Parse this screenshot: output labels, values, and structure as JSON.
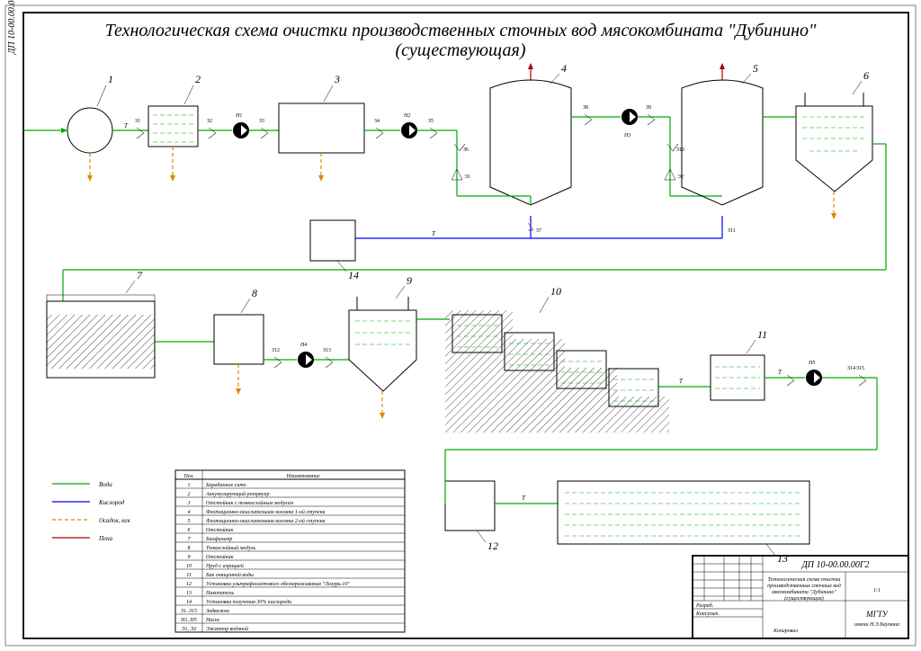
{
  "title_l1": "Технологическая схема очистки производственных сточных вод мясокомбината \"Дубинино\"",
  "title_l2": "(существующая)",
  "frame_code": "ДП 10-00.00.00Г2",
  "legend": {
    "water": "Вода",
    "oxygen": "Кислород",
    "sludge": "Осадок, кек",
    "foam": "Пена"
  },
  "header": {
    "pos": "Поз.",
    "name": "Наименование"
  },
  "equip": [
    {
      "p": "1",
      "n": "Барабанное сито"
    },
    {
      "p": "2",
      "n": "Аккумулирующий резервуар"
    },
    {
      "p": "3",
      "n": "Отстойник с тонкослойным модулем"
    },
    {
      "p": "4",
      "n": "Флотационно-окислительная колонна 1-ой ступени"
    },
    {
      "p": "5",
      "n": "Флотационно-окислительная колонна 2-ой ступени"
    },
    {
      "p": "6",
      "n": "Отстойник"
    },
    {
      "p": "7",
      "n": "Биофильтр"
    },
    {
      "p": "8",
      "n": "Тонкослойный модуль"
    },
    {
      "p": "9",
      "n": "Отстойник"
    },
    {
      "p": "10",
      "n": "Пруд с аэрацией"
    },
    {
      "p": "11",
      "n": "Бак очищенной воды"
    },
    {
      "p": "12",
      "n": "Установка ультрафиолетового обеззараживания \"Лазурь-10\""
    },
    {
      "p": "13",
      "n": "Накопитель"
    },
    {
      "p": "14",
      "n": "Установка получения 30% кислорода"
    },
    {
      "p": "З1..З15",
      "n": "Задвижка"
    },
    {
      "p": "Н1..Н5",
      "n": "Насос"
    },
    {
      "p": "Э1, Э2",
      "n": "Эжектор водяной"
    }
  ],
  "org": "МГТУ\nимени Н.Э.Баумана",
  "stamp_title": "Технологическая схема очистки производственных сточных вод мясокомбината \"Дубинино\" (существующая)",
  "sheet": "1:1",
  "pipes": {
    "T": "Т",
    "Z": "З",
    "N": "Н",
    "E": "Э"
  }
}
